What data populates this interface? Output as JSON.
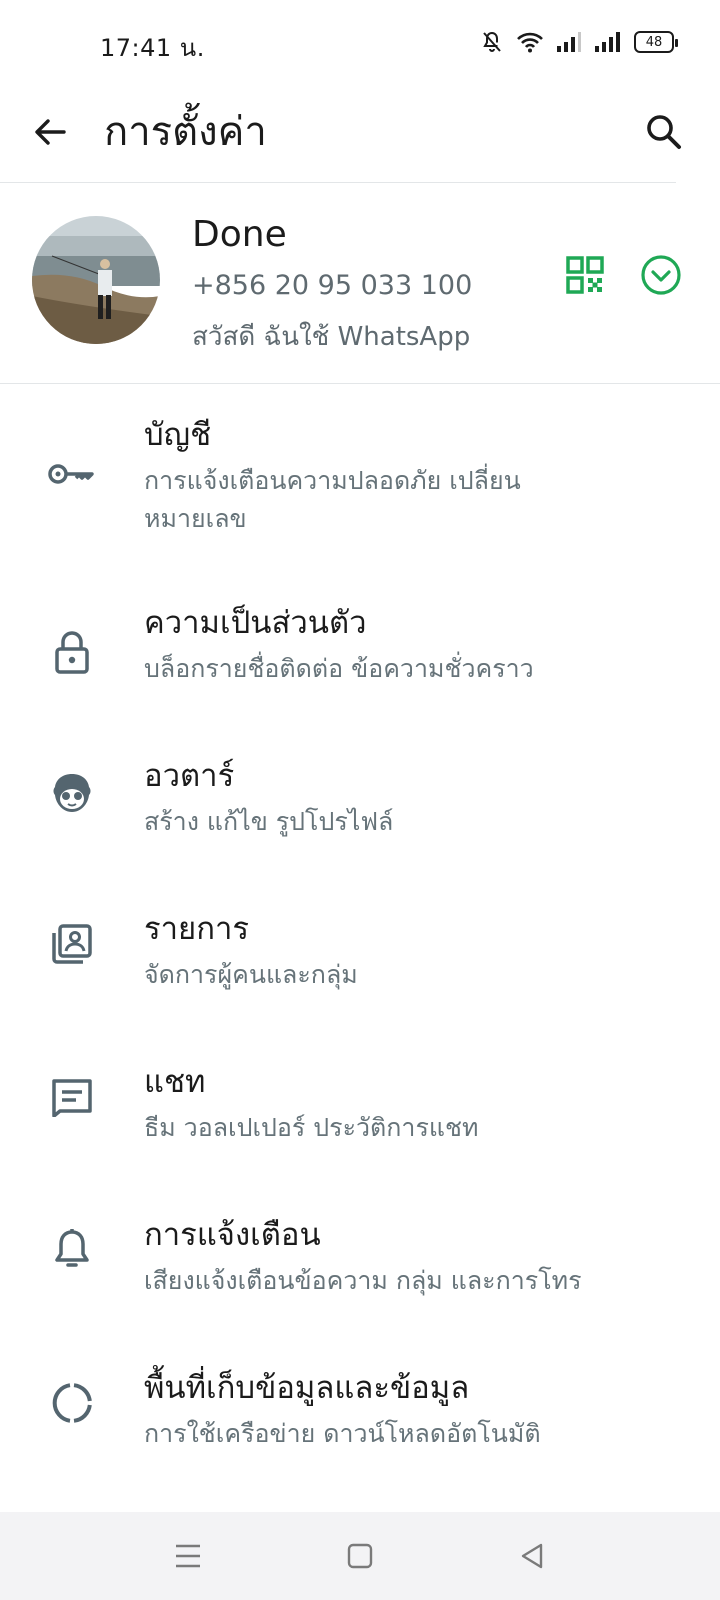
{
  "status_bar": {
    "time": "17:41 น.",
    "battery": "48"
  },
  "app_bar": {
    "title": "การตั้งค่า"
  },
  "profile": {
    "name": "Done",
    "phone": "+856 20 95 033 100",
    "about": "สวัสดี ฉันใช้ WhatsApp"
  },
  "colors": {
    "accent": "#1fa855",
    "icon_gray": "#54656f"
  },
  "settings": [
    {
      "icon": "key-icon",
      "title": "บัญชี",
      "subtitle": "การแจ้งเตือนความปลอดภัย เปลี่ยน หมายเลข"
    },
    {
      "icon": "lock-icon",
      "title": "ความเป็นส่วนตัว",
      "subtitle": "บล็อกรายชื่อติดต่อ ข้อความชั่วคราว"
    },
    {
      "icon": "avatar-face-icon",
      "title": "อวตาร์",
      "subtitle": "สร้าง แก้ไข รูปโปรไฟล์"
    },
    {
      "icon": "contacts-list-icon",
      "title": "รายการ",
      "subtitle": "จัดการผู้คนและกลุ่ม"
    },
    {
      "icon": "chat-icon",
      "title": "แชท",
      "subtitle": "ธีม วอลเปเปอร์ ประวัติการแชท"
    },
    {
      "icon": "bell-icon",
      "title": "การแจ้งเตือน",
      "subtitle": "เสียงแจ้งเตือนข้อความ กลุ่ม และการโทร"
    },
    {
      "icon": "storage-icon",
      "title": "พื้นที่เก็บข้อมูลและข้อมูล",
      "subtitle": "การใช้เครือข่าย ดาวน์โหลดอัตโนมัติ"
    }
  ]
}
